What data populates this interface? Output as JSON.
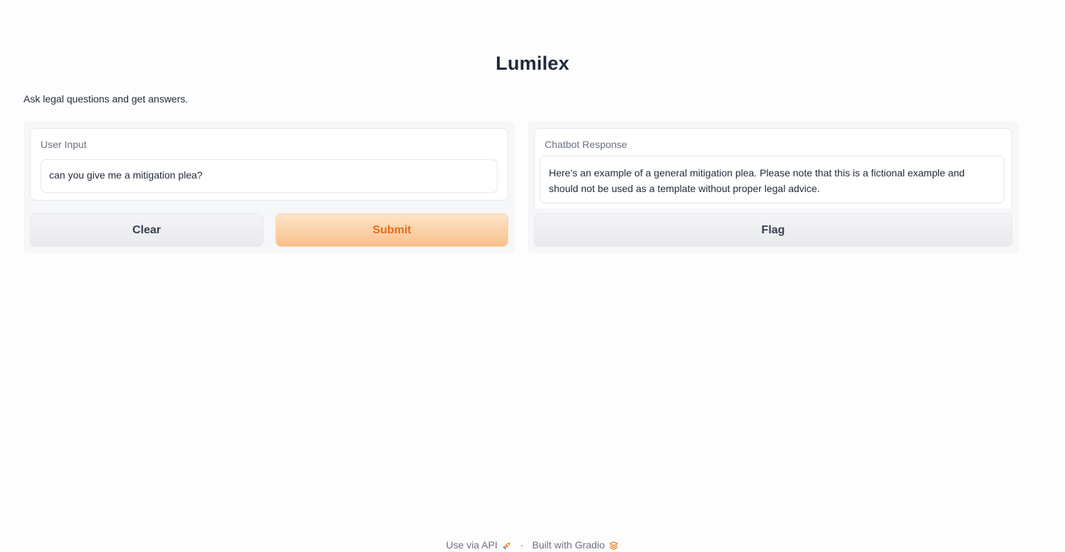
{
  "app": {
    "title": "Lumilex",
    "description": "Ask legal questions and get answers."
  },
  "input_panel": {
    "label": "User Input",
    "value": "can you give me a mitigation plea?",
    "clear_label": "Clear",
    "submit_label": "Submit"
  },
  "output_panel": {
    "label": "Chatbot Response",
    "value": "Here's an example of a general mitigation plea. Please note that this is a fictional example and should not be used as a template without proper legal advice.",
    "flag_label": "Flag"
  },
  "footer": {
    "api_link": "Use via API",
    "separator": "·",
    "built_with": "Built with Gradio",
    "api_icon": "rocket-icon",
    "gradio_icon": "gradio-logo-icon"
  },
  "colors": {
    "accent": "#ea6a1f",
    "primary_button_bg": "#f8c08b"
  }
}
